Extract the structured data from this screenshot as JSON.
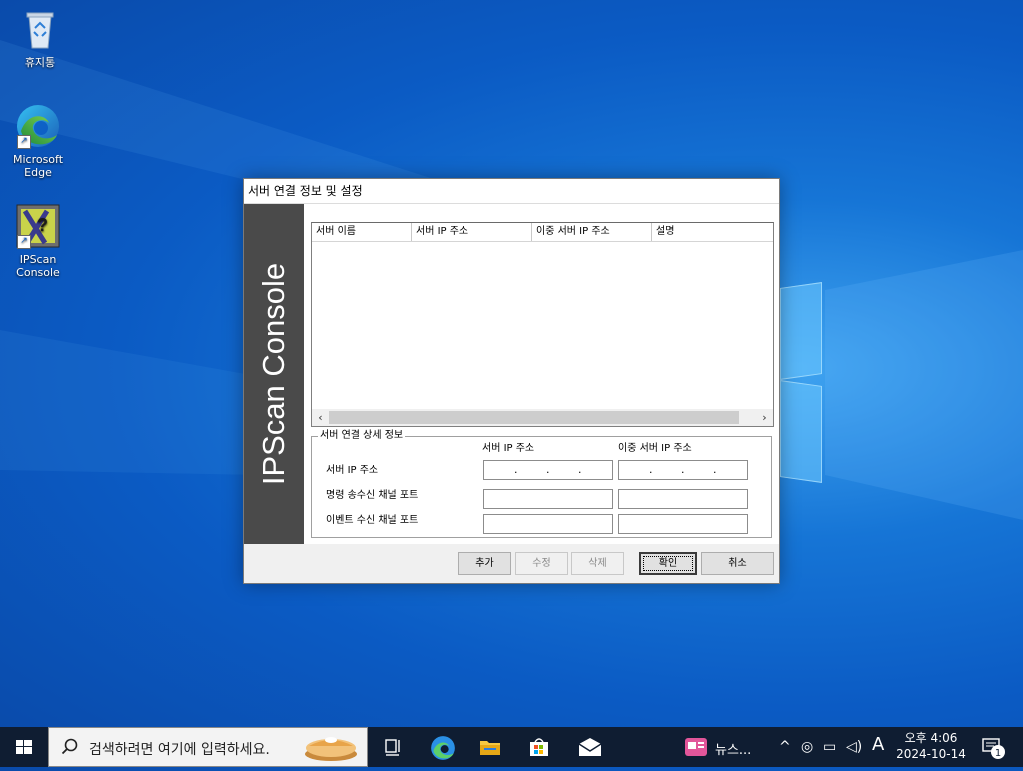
{
  "desktop": {
    "icons": [
      {
        "label": "휴지통"
      },
      {
        "label": "Microsoft Edge"
      },
      {
        "label": "IPScan Console"
      }
    ]
  },
  "dialog": {
    "title": "서버 연결 정보 및 설정",
    "brand_text": "IPScan Console",
    "list": {
      "columns": [
        "서버 이름",
        "서버 IP 주소",
        "이중 서버 IP 주소",
        "설명"
      ],
      "rows": []
    },
    "group": {
      "title": "서버 연결 상세 정보",
      "col_headers": [
        "서버 IP 주소",
        "이중 서버 IP 주소"
      ],
      "row_labels": [
        "서버 IP 주소",
        "명령 송수신 채널 포트",
        "이벤트 수신 채널 포트"
      ],
      "ip_primary": ". . .",
      "ip_secondary": ". . .",
      "port_cmd_primary": "",
      "port_cmd_secondary": "",
      "port_evt_primary": "",
      "port_evt_secondary": ""
    },
    "buttons": {
      "add": "추가",
      "edit": "수정",
      "delete": "삭제",
      "ok": "확인",
      "cancel": "취소"
    }
  },
  "taskbar": {
    "search_placeholder": "검색하려면 여기에 입력하세요.",
    "news_label": "뉴스...",
    "ime_label": "A",
    "clock_time": "오후 4:06",
    "clock_date": "2024-10-14",
    "notification_count": "1"
  },
  "colors": {
    "desktop_blue": "#0b5bc4",
    "taskbar": "#0f1d32",
    "brand_band": "#4a4a4a"
  }
}
